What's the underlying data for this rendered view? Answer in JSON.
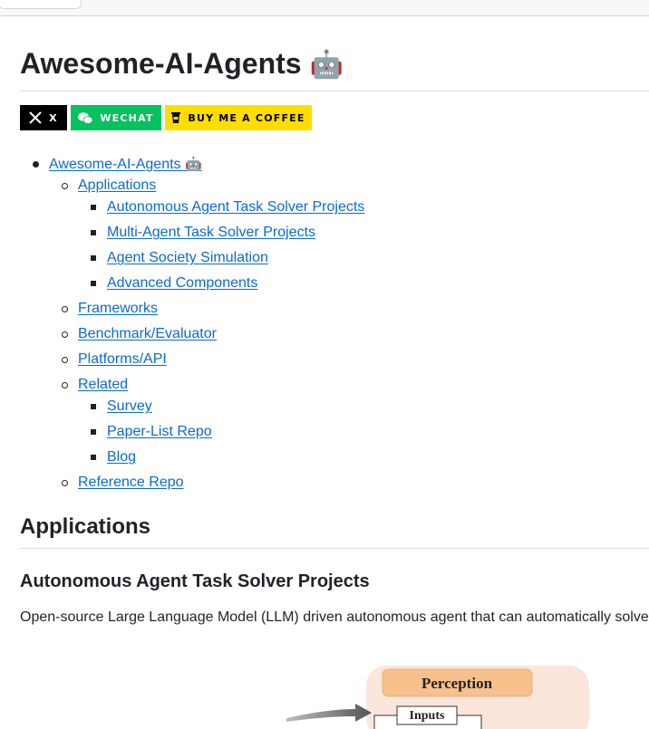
{
  "page": {
    "title": "Awesome-AI-Agents",
    "title_emoji": "🤖"
  },
  "badges": {
    "x_label": "X",
    "wechat_label": "WECHAT",
    "coffee_label": "BUY ME A COFFEE"
  },
  "toc": {
    "root": {
      "label": "Awesome-AI-Agents",
      "emoji": "🤖"
    },
    "applications": "Applications",
    "autonomous": "Autonomous Agent Task Solver Projects",
    "multi_agent": "Multi-Agent Task Solver Projects",
    "society": "Agent Society Simulation",
    "advanced": "Advanced Components",
    "frameworks": "Frameworks",
    "benchmark": "Benchmark/Evaluator",
    "platforms": "Platforms/API",
    "related": "Related",
    "survey": "Survey",
    "paper_list": "Paper-List Repo",
    "blog": "Blog",
    "reference": "Reference Repo"
  },
  "sections": {
    "applications_heading": "Applications",
    "autonomous_heading": "Autonomous Agent Task Solver Projects",
    "autonomous_desc": "Open-source Large Language Model (LLM) driven autonomous agent that can automatically solve"
  },
  "figure": {
    "perception_label": "Perception",
    "inputs_label": "Inputs"
  },
  "colors": {
    "link": "#0969da",
    "wechat_green": "#07c160",
    "coffee_yellow": "#ffdd00"
  }
}
